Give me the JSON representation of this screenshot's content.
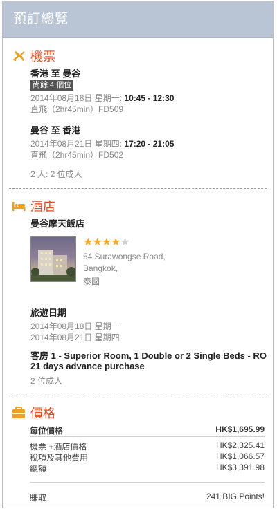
{
  "header": {
    "title": "預訂總覽"
  },
  "flight": {
    "title": "機票",
    "outbound": {
      "route": "香港 至 曼谷",
      "seats_badge": "尚餘 4 個位",
      "date": "2014年08月18日 星期一:",
      "time": "10:45 - 12:30",
      "details": "直飛（2hr45min）FD509"
    },
    "return": {
      "route": "曼谷 至 香港",
      "date": "2014年08月21日 星期四:",
      "time": "17:20 - 21:05",
      "details": "直飛（2hr45min）FD502"
    },
    "pax": "2 人:  2 位成人"
  },
  "hotel": {
    "title": "酒店",
    "name": "曼谷摩天飯店",
    "rating": 4,
    "rating_max": 5,
    "address_line1": "54 Surawongse Road,",
    "address_line2": "Bangkok,",
    "address_line3": "泰國",
    "travel_dates_label": "旅遊日期",
    "checkin": "2014年08月18日  星期一",
    "checkout": "2014年08月21日  星期四",
    "room": "客房 1 - Superior Room, 1 Double or 2 Single Beds - RO 21 days advance purchase",
    "guests": "2 位成人"
  },
  "price": {
    "title": "價格",
    "per_person_label": "每位價格",
    "per_person_value": "HK$1,695.99",
    "flight_hotel_label": "機票 +酒店價格",
    "flight_hotel_value": "HK$2,325.41",
    "tax_label": "稅項及其他費用",
    "tax_value": "HK$1,066.57",
    "total_label": "總額",
    "total_value": "HK$3,391.98",
    "earn_label": "賺取",
    "earn_value": "241 BIG Points!"
  },
  "colors": {
    "accent": "#e34a1f",
    "icon": "#f0a020",
    "header_bg": "#b9c4d4"
  }
}
